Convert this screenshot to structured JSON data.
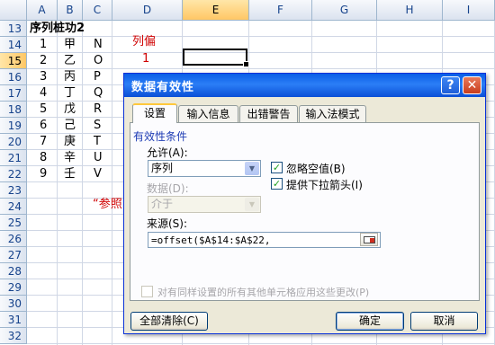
{
  "spreadsheet": {
    "columns": [
      "A",
      "B",
      "C",
      "D",
      "E",
      "F",
      "G",
      "H",
      "I"
    ],
    "selected_column": "E",
    "rows": [
      "13",
      "14",
      "15",
      "16",
      "17",
      "18",
      "19",
      "20",
      "21",
      "22",
      "23",
      "24",
      "25",
      "26",
      "27",
      "28",
      "29",
      "30",
      "31",
      "32"
    ],
    "selected_row": "15",
    "cells": {
      "a13": "序列桩功2",
      "d14": "列偏",
      "d15": "1",
      "c24": "“参照",
      "numbers": [
        "1",
        "2",
        "3",
        "4",
        "5",
        "6",
        "7",
        "8",
        "9"
      ],
      "stems": [
        "甲",
        "乙",
        "丙",
        "丁",
        "戊",
        "己",
        "庚",
        "辛",
        "壬"
      ],
      "letters": [
        "N",
        "O",
        "P",
        "Q",
        "R",
        "S",
        "T",
        "U",
        "V"
      ]
    },
    "colors": {
      "red_text": "#d00000",
      "header_text": "#15428b"
    }
  },
  "dialog": {
    "title": "数据有效性",
    "help_label": "?",
    "close_label": "✕",
    "tabs": [
      {
        "label": "设置"
      },
      {
        "label": "输入信息"
      },
      {
        "label": "出错警告"
      },
      {
        "label": "输入法模式"
      }
    ],
    "group_title": "有效性条件",
    "allow_label": "允许(A):",
    "allow_value": "序列",
    "data_label": "数据(D):",
    "data_value": "介于",
    "ignore_blank_label": "忽略空值(B)",
    "ignore_blank_checked": true,
    "dropdown_arrow_label": "提供下拉箭头(I)",
    "dropdown_arrow_checked": true,
    "source_label": "来源(S):",
    "source_value": "=offset($A$14:$A$22,",
    "apply_all_label": "对有同样设置的所有其他单元格应用这些更改(P)",
    "apply_all_checked": false,
    "clear_all_label": "全部清除(C)",
    "ok_label": "确定",
    "cancel_label": "取消"
  }
}
